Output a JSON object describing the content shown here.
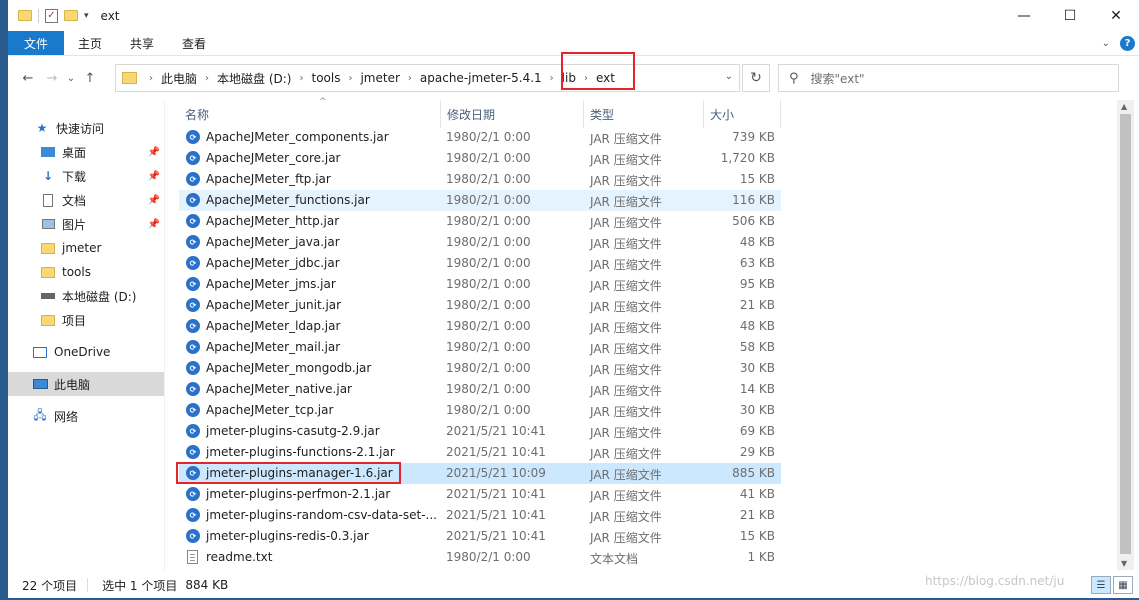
{
  "window": {
    "title": "ext",
    "controls": {
      "minimize": "—",
      "maximize": "☐",
      "close": "✕"
    }
  },
  "ribbon": {
    "tabs": [
      "文件",
      "主页",
      "共享",
      "查看"
    ],
    "help": "?"
  },
  "nav": {
    "back": "←",
    "forward": "→",
    "recent": "⌄",
    "up": "↑",
    "breadcrumb": [
      "此电脑",
      "本地磁盘 (D:)",
      "tools",
      "jmeter",
      "apache-jmeter-5.4.1",
      "lib",
      "ext"
    ],
    "refresh": "↻",
    "search_placeholder": "搜索\"ext\""
  },
  "sidebar": {
    "items": [
      {
        "label": "快速访问",
        "icon": "star-icon",
        "pinned": false
      },
      {
        "label": "桌面",
        "icon": "desktop-icon",
        "pinned": true
      },
      {
        "label": "下载",
        "icon": "download-icon",
        "pinned": true
      },
      {
        "label": "文档",
        "icon": "document-icon",
        "pinned": true
      },
      {
        "label": "图片",
        "icon": "picture-icon",
        "pinned": true
      },
      {
        "label": "jmeter",
        "icon": "folder-icon",
        "pinned": false
      },
      {
        "label": "tools",
        "icon": "folder-icon",
        "pinned": false
      },
      {
        "label": "本地磁盘 (D:)",
        "icon": "drive-icon",
        "pinned": false
      },
      {
        "label": "项目",
        "icon": "folder-icon",
        "pinned": false
      },
      {
        "label": "OneDrive",
        "icon": "onedrive-icon",
        "pinned": false
      },
      {
        "label": "此电脑",
        "icon": "computer-icon",
        "pinned": false
      },
      {
        "label": "网络",
        "icon": "network-icon",
        "pinned": false
      }
    ]
  },
  "columns": [
    "名称",
    "修改日期",
    "类型",
    "大小"
  ],
  "files": [
    {
      "name": "ApacheJMeter_components.jar",
      "date": "1980/2/1 0:00",
      "type": "JAR 压缩文件",
      "size": "739 KB"
    },
    {
      "name": "ApacheJMeter_core.jar",
      "date": "1980/2/1 0:00",
      "type": "JAR 压缩文件",
      "size": "1,720 KB"
    },
    {
      "name": "ApacheJMeter_ftp.jar",
      "date": "1980/2/1 0:00",
      "type": "JAR 压缩文件",
      "size": "15 KB"
    },
    {
      "name": "ApacheJMeter_functions.jar",
      "date": "1980/2/1 0:00",
      "type": "JAR 压缩文件",
      "size": "116 KB"
    },
    {
      "name": "ApacheJMeter_http.jar",
      "date": "1980/2/1 0:00",
      "type": "JAR 压缩文件",
      "size": "506 KB"
    },
    {
      "name": "ApacheJMeter_java.jar",
      "date": "1980/2/1 0:00",
      "type": "JAR 压缩文件",
      "size": "48 KB"
    },
    {
      "name": "ApacheJMeter_jdbc.jar",
      "date": "1980/2/1 0:00",
      "type": "JAR 压缩文件",
      "size": "63 KB"
    },
    {
      "name": "ApacheJMeter_jms.jar",
      "date": "1980/2/1 0:00",
      "type": "JAR 压缩文件",
      "size": "95 KB"
    },
    {
      "name": "ApacheJMeter_junit.jar",
      "date": "1980/2/1 0:00",
      "type": "JAR 压缩文件",
      "size": "21 KB"
    },
    {
      "name": "ApacheJMeter_ldap.jar",
      "date": "1980/2/1 0:00",
      "type": "JAR 压缩文件",
      "size": "48 KB"
    },
    {
      "name": "ApacheJMeter_mail.jar",
      "date": "1980/2/1 0:00",
      "type": "JAR 压缩文件",
      "size": "58 KB"
    },
    {
      "name": "ApacheJMeter_mongodb.jar",
      "date": "1980/2/1 0:00",
      "type": "JAR 压缩文件",
      "size": "30 KB"
    },
    {
      "name": "ApacheJMeter_native.jar",
      "date": "1980/2/1 0:00",
      "type": "JAR 压缩文件",
      "size": "14 KB"
    },
    {
      "name": "ApacheJMeter_tcp.jar",
      "date": "1980/2/1 0:00",
      "type": "JAR 压缩文件",
      "size": "30 KB"
    },
    {
      "name": "jmeter-plugins-casutg-2.9.jar",
      "date": "2021/5/21 10:41",
      "type": "JAR 压缩文件",
      "size": "69 KB"
    },
    {
      "name": "jmeter-plugins-functions-2.1.jar",
      "date": "2021/5/21 10:41",
      "type": "JAR 压缩文件",
      "size": "29 KB"
    },
    {
      "name": "jmeter-plugins-manager-1.6.jar",
      "date": "2021/5/21 10:09",
      "type": "JAR 压缩文件",
      "size": "885 KB"
    },
    {
      "name": "jmeter-plugins-perfmon-2.1.jar",
      "date": "2021/5/21 10:41",
      "type": "JAR 压缩文件",
      "size": "41 KB"
    },
    {
      "name": "jmeter-plugins-random-csv-data-set-...",
      "date": "2021/5/21 10:41",
      "type": "JAR 压缩文件",
      "size": "21 KB"
    },
    {
      "name": "jmeter-plugins-redis-0.3.jar",
      "date": "2021/5/21 10:41",
      "type": "JAR 压缩文件",
      "size": "15 KB"
    },
    {
      "name": "readme.txt",
      "date": "1980/2/1 0:00",
      "type": "文本文档",
      "size": "1 KB"
    }
  ],
  "selected_index": 16,
  "hover_index": 3,
  "status": {
    "count": "22 个项目",
    "selection": "选中 1 个项目",
    "selection_size": "884 KB"
  },
  "watermark": "https://blog.csdn.net/ju",
  "colors": {
    "accent": "#1979ca",
    "highlight": "#e0252b",
    "selection": "#cce8ff"
  }
}
